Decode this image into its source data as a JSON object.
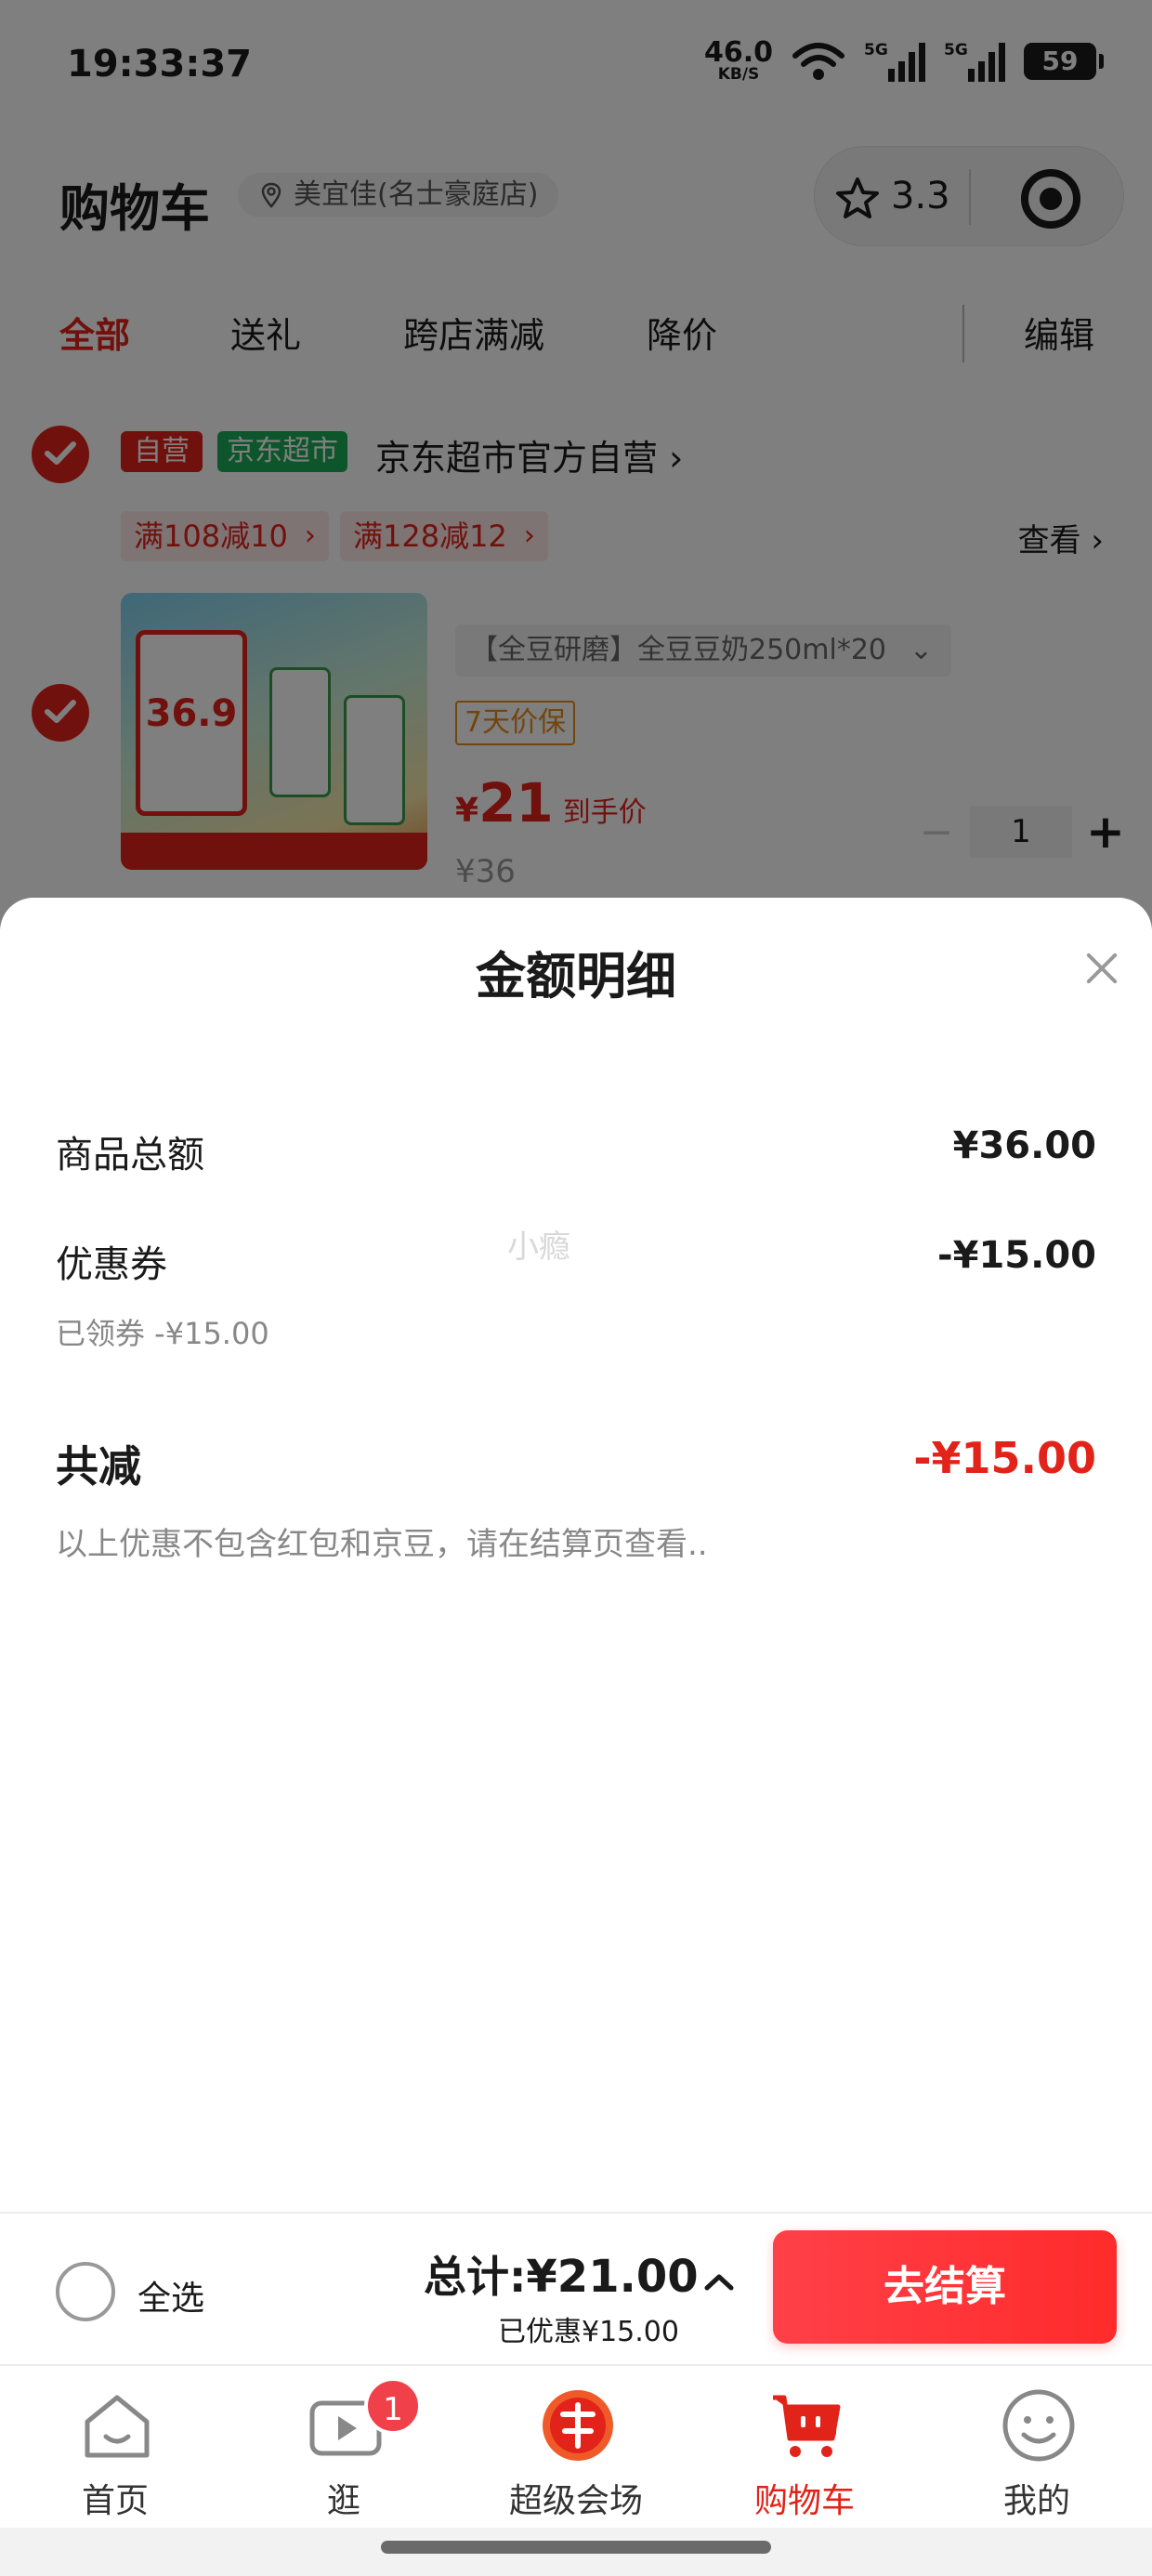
{
  "status_bar": {
    "time": "19:33:37",
    "net_speed": "46.0",
    "net_unit": "KB/S",
    "sim1": "5G",
    "sim2": "5G",
    "battery": "59"
  },
  "header": {
    "title": "购物车",
    "store": "美宜佳(名士豪庭店)",
    "rating": "3.3"
  },
  "tabs": [
    {
      "label": "全部",
      "active": true
    },
    {
      "label": "送礼"
    },
    {
      "label": "跨店满减"
    },
    {
      "label": "降价"
    }
  ],
  "edit_label": "编辑",
  "shop": {
    "badge_self": "自营",
    "badge_jd": "京东超市",
    "name": "京东超市官方自营 ›",
    "promos": [
      "满108减10",
      "满128减12"
    ],
    "view_label": "查看 ›"
  },
  "product": {
    "image_price": "36.9",
    "variant": "【全豆研磨】全豆豆奶250ml*20",
    "price_protect": "7天价保",
    "currency": "¥",
    "price": "21",
    "price_suffix": "到手价",
    "original_price": "¥36",
    "quantity": "1",
    "minus": "−",
    "plus": "+"
  },
  "sheet": {
    "title": "金额明细",
    "rows": [
      {
        "label": "商品总额",
        "value": "¥36.00"
      },
      {
        "label": "优惠券",
        "value": "-¥15.00",
        "note": "已领券 -¥15.00"
      }
    ],
    "watermark": "小瘾",
    "total_label": "共减",
    "total_value": "-¥15.00",
    "disclaimer": "以上优惠不包含红包和京豆，请在结算页查看.."
  },
  "checkout": {
    "select_all": "全选",
    "total_prefix": "总计:",
    "total_amount": "¥21.00",
    "saved": "已优惠¥15.00",
    "button": "去结算"
  },
  "tabbar": [
    {
      "label": "首页",
      "icon": "home-icon"
    },
    {
      "label": "逛",
      "icon": "video-icon",
      "badge": "1"
    },
    {
      "label": "超级会场",
      "icon": "venue-icon"
    },
    {
      "label": "购物车",
      "icon": "cart-icon",
      "active": true
    },
    {
      "label": "我的",
      "icon": "profile-icon"
    }
  ],
  "colors": {
    "accent": "#e2231a",
    "jd_green": "#1aaa55",
    "button": "#ff2b2b"
  }
}
